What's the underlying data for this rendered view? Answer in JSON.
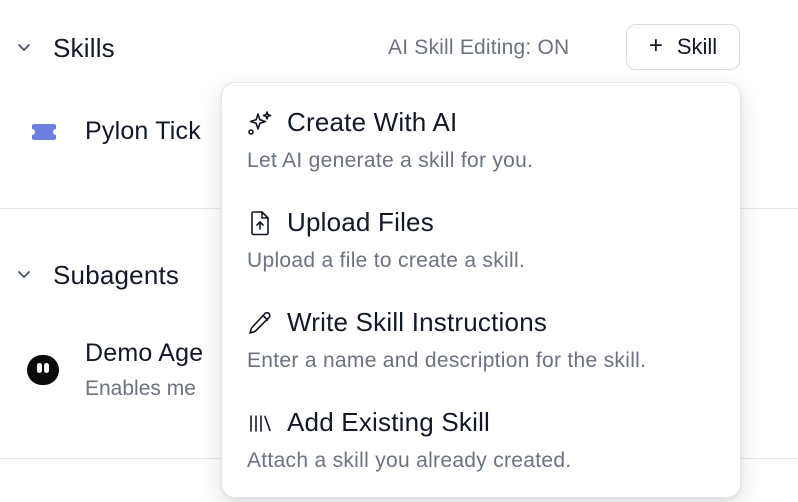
{
  "skills_section": {
    "title": "Skills",
    "ai_skill_editing": "AI Skill Editing: ON",
    "add_button_label": "Skill",
    "items": [
      {
        "label": "Pylon Tick",
        "icon": "ticket-icon",
        "icon_color": "#6b7fe0"
      }
    ]
  },
  "subagents_section": {
    "title": "Subagents",
    "items": [
      {
        "label": "Demo Age",
        "description": "Enables me",
        "icon": "agent-avatar"
      }
    ]
  },
  "add_skill_menu": {
    "items": [
      {
        "icon": "sparkles-icon",
        "title": "Create With AI",
        "description": "Let AI generate a skill for you."
      },
      {
        "icon": "file-upload-icon",
        "title": "Upload Files",
        "description": "Upload a file to create a skill."
      },
      {
        "icon": "pencil-icon",
        "title": "Write Skill Instructions",
        "description": "Enter a name and description for the skill."
      },
      {
        "icon": "library-icon",
        "title": "Add Existing Skill",
        "description": "Attach a skill you already created."
      }
    ]
  }
}
